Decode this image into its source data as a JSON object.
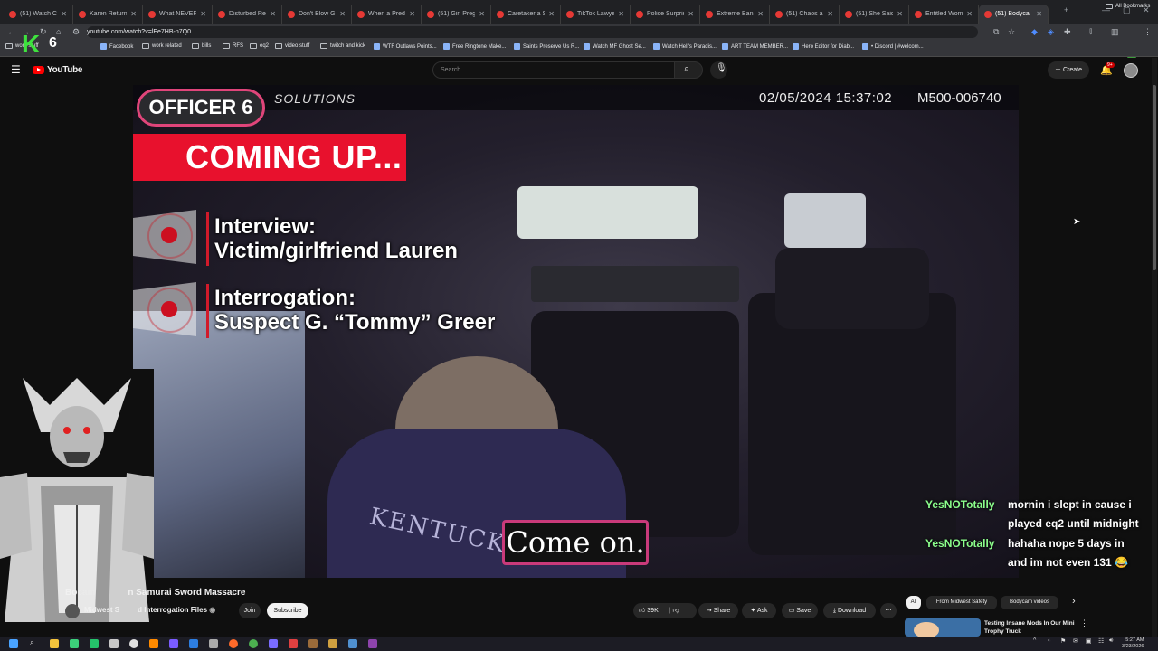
{
  "browser": {
    "tabs": [
      {
        "label": "(51) Watch Cop",
        "active": false
      },
      {
        "label": "Karen Returns t",
        "active": false
      },
      {
        "label": "What NEVER To",
        "active": false
      },
      {
        "label": "Disturbed Resid",
        "active": false
      },
      {
        "label": "Don't Blow Gra",
        "active": false
      },
      {
        "label": "When a Predato",
        "active": false
      },
      {
        "label": "(51) Girl Pregn",
        "active": false
      },
      {
        "label": "Caretaker a Ski",
        "active": false
      },
      {
        "label": "TikTok Lawyer",
        "active": false
      },
      {
        "label": "Police Surprise",
        "active": false
      },
      {
        "label": "Extreme Banshi",
        "active": false
      },
      {
        "label": "(51) Chaos and",
        "active": false
      },
      {
        "label": "(51) She Said S",
        "active": false
      },
      {
        "label": "Entitled Woma",
        "active": false
      },
      {
        "label": "(51) Bodyca",
        "active": true
      }
    ],
    "url": "youtube.com/watch?v=lEe7HB-n7Q0",
    "bookmarks": [
      {
        "label": "work stuff",
        "type": "folder"
      },
      {
        "label": "Facebook",
        "type": "site"
      },
      {
        "label": "work related",
        "type": "folder"
      },
      {
        "label": "bills",
        "type": "folder"
      },
      {
        "label": "RFS",
        "type": "folder"
      },
      {
        "label": "eq2",
        "type": "folder"
      },
      {
        "label": "video stuff",
        "type": "folder"
      },
      {
        "label": "twitch and kick",
        "type": "folder"
      },
      {
        "label": "WTF Outlaws Points...",
        "type": "site"
      },
      {
        "label": "Free Ringtone Make...",
        "type": "site"
      },
      {
        "label": "Saints Preserve Us R...",
        "type": "site"
      },
      {
        "label": "Watch MF Ghost Se...",
        "type": "site"
      },
      {
        "label": "Watch Hell's Paradis...",
        "type": "site"
      },
      {
        "label": "ART TEAM MEMBER...",
        "type": "site"
      },
      {
        "label": "Hero Editor for Diab...",
        "type": "site"
      },
      {
        "label": "• Discord | #welcom...",
        "type": "site"
      }
    ],
    "all_bookmarks_label": "All Bookmarks",
    "accent": "#e53935"
  },
  "stream_logo": {
    "letter": "K",
    "number": "6"
  },
  "youtube": {
    "logo_label": "YouTube",
    "search_placeholder": "Search",
    "create_label": "Create",
    "notification_badge": "9+"
  },
  "video": {
    "officer_label": "OFFICER 6",
    "solutions_label": "SOLUTIONS",
    "timestamp": "02/05/2024  15:37:02",
    "camera_id": "M500-006740",
    "coming_up": "COMING UP...",
    "agenda": [
      {
        "line1": "Interview:",
        "line2": "Victim/girlfriend Lauren"
      },
      {
        "line1": "Interrogation:",
        "line2": "Suspect G. “Tommy” Greer"
      }
    ],
    "hoodie_text": "KENTUCKY",
    "caption": "Come on."
  },
  "chat": [
    {
      "user": "YesNOTotally",
      "message_line1": "mornin i slept in cause i",
      "message_line2": "played eq2 until midnight"
    },
    {
      "user": "YesNOTotally",
      "message_line1": "hahaha nope 5 days in",
      "message_line2": "and im not even 131 😂"
    }
  ],
  "below_video": {
    "title_start": "Bo",
    "title_mid": "cam",
    "title_end": "n Samurai Sword Massacre",
    "channel_start": "Midwest S",
    "channel_end": "d Interrogation Files",
    "join_label": "Join",
    "subscribe_label": "Subscribe",
    "likes": "39K",
    "share_label": "Share",
    "ask_label": "Ask",
    "save_label": "Save",
    "download_label": "Download"
  },
  "sidebar": {
    "chips": [
      "All",
      "From Midwest Safety",
      "Bodycam videos"
    ],
    "recommended_title": "Testing Insane Mods In Our Mini Trophy Truck"
  },
  "taskbar": {
    "time": "5:27 AM",
    "date": "3/23/2026"
  }
}
